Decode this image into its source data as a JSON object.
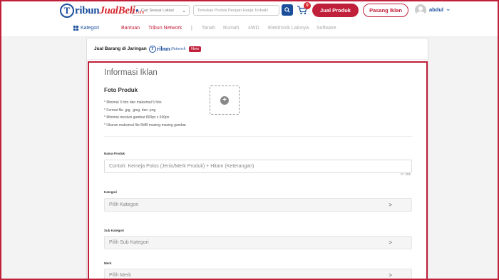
{
  "header": {
    "logo": {
      "mark": "T",
      "brand_1": "ribun",
      "brand_2": "JualBeli",
      "domain": ".com"
    },
    "location": {
      "placeholder": "Cari Sesuai Lokasi"
    },
    "search": {
      "placeholder": "Temukan Produk Dengan Harga Terbaik!"
    },
    "cart_count": "0",
    "jual_label": "Jual Produk",
    "pasang_label": "Pasang Iklan",
    "user_name": "abdul"
  },
  "nav": {
    "kategori": "Kategori",
    "bantuan": "Bantuan",
    "network": "Tribun Network",
    "separator": "|",
    "categories": [
      "Tanah",
      "Rumah",
      "4WD",
      "Elektronik Lainnya",
      "Software"
    ]
  },
  "card": {
    "title": "Jual Barang di Jaringan",
    "network_logo": {
      "mark": "T",
      "brand": "ribun",
      "suffix": "Network"
    },
    "badge": "New"
  },
  "form": {
    "title": "Informasi Iklan",
    "photo": {
      "title": "Foto Produk",
      "requirements": [
        "* Minimal 3 foto dan maksimal 5 foto",
        "* Format file .jpg, .jpeg, dan .png",
        "* Minimal resolusi gambar 800px x 600px",
        "* Ukuran maksimal file 5MB masing-masing gambar"
      ],
      "add_icon": "plus-circle-icon"
    },
    "nama_produk": {
      "label": "Nama Produk",
      "placeholder": "Contoh: Kemeja Polos (Jenis/Merk Produk) + Hitam (Keterangan)",
      "counter": "0 / 255"
    },
    "kategori": {
      "label": "Kategori",
      "placeholder": "Pilih Kategori",
      "arrow": ">"
    },
    "sub_kategori": {
      "label": "Sub Kategori",
      "placeholder": "Pilih Sub Kategori",
      "arrow": ">"
    },
    "merk": {
      "label": "Merk",
      "placeholder": "Pilih Merk",
      "arrow": ">"
    }
  },
  "colors": {
    "brand_blue": "#1b4f9c",
    "brand_red": "#c0203a"
  }
}
